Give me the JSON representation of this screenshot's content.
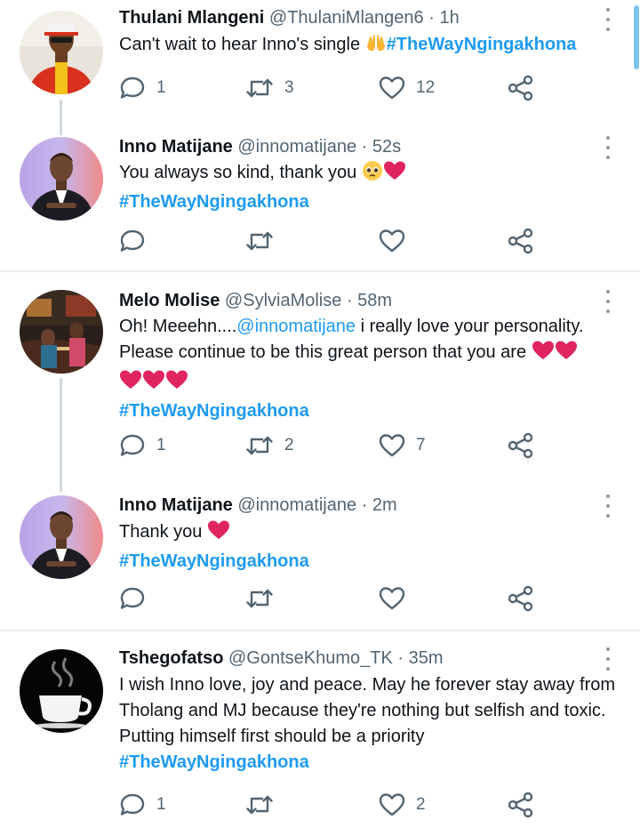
{
  "tweets": [
    {
      "name": "Thulani Mlangeni",
      "handle": "@ThulaniMlangen6",
      "time": "1h",
      "text1": "Can't wait to hear Inno's single ",
      "hashtag": "#TheWayNgingakhona",
      "replies": "1",
      "retweets": "3",
      "likes": "12",
      "avatar_icon": "person-red-jacket-avatar"
    },
    {
      "name": "Inno Matijane",
      "handle": "@innomatijane",
      "time": "52s",
      "text1": "You always so kind, thank you ",
      "hashtag": "#TheWayNgingakhona",
      "replies": "",
      "retweets": "",
      "likes": "",
      "avatar_icon": "person-suit-avatar"
    },
    {
      "name": "Melo Molise",
      "handle": "@SylviaMolise",
      "time": "58m",
      "text1": "Oh! Meeehn....",
      "mention": "@innomatijane",
      "text2": " i really love your personality. Please continue to be this great person that you are ",
      "hashtag": "#TheWayNgingakhona",
      "replies": "1",
      "retweets": "2",
      "likes": "7",
      "avatar_icon": "stage-photo-avatar"
    },
    {
      "name": "Inno Matijane",
      "handle": "@innomatijane",
      "time": "2m",
      "text1": "Thank you ",
      "hashtag": "#TheWayNgingakhona",
      "replies": "",
      "retweets": "",
      "likes": "",
      "avatar_icon": "person-suit-avatar"
    },
    {
      "name": "Tshegofatso",
      "handle": "@GontseKhumo_TK",
      "time": "35m",
      "text1": "I wish Inno love, joy and peace. May he forever stay away from Tholang and MJ because they're nothing but selfish and toxic. Putting himself first should be a priority",
      "hashtag": "#TheWayNgingakhona",
      "replies": "1",
      "retweets": "",
      "likes": "2",
      "avatar_icon": "coffee-cup-avatar"
    }
  ],
  "separator": "·",
  "icons": {
    "reply": "reply-icon",
    "retweet": "retweet-icon",
    "like": "heart-icon",
    "share": "share-icon",
    "more": "more-icon"
  },
  "colors": {
    "link": "#1d9bf0",
    "muted": "#536471",
    "heart_emoji": "#e0245e"
  }
}
